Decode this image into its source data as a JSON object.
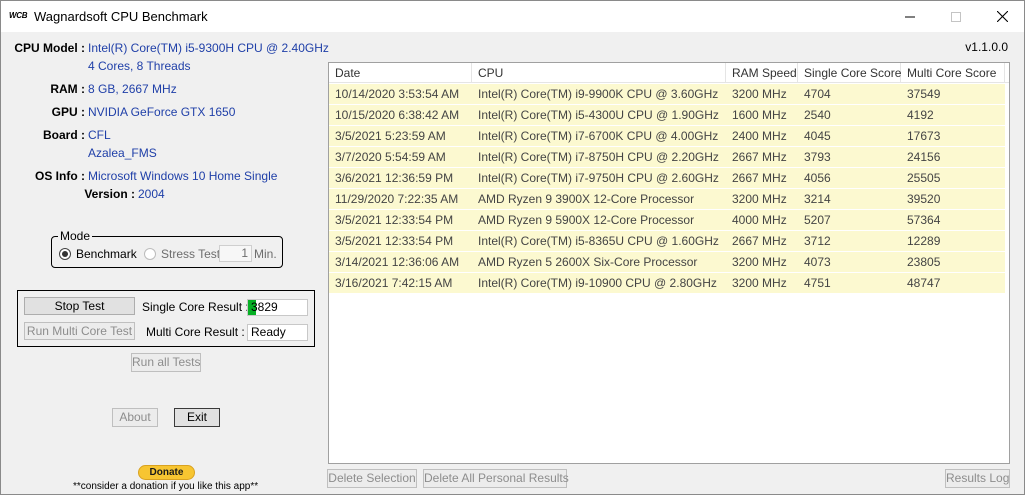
{
  "window": {
    "logo": "WCB",
    "title": "Wagnardsoft CPU Benchmark"
  },
  "system": {
    "cpu_label": "CPU Model :",
    "cpu_line1": "Intel(R) Core(TM) i5-9300H CPU @ 2.40GHz",
    "cpu_line2": "4 Cores, 8 Threads",
    "ram_label": "RAM :",
    "ram": "8 GB, 2667 MHz",
    "gpu_label": "GPU :",
    "gpu": "NVIDIA GeForce GTX 1650",
    "board_label": "Board :",
    "board_line1": "CFL",
    "board_line2": "Azalea_FMS",
    "os_label": "OS Info :",
    "os": "Microsoft Windows 10 Home Single",
    "version_label": "Version :",
    "os_version": "2004"
  },
  "app_version": "v1.1.0.0",
  "mode": {
    "title": "Mode",
    "benchmark_label": "Benchmark",
    "stress_label": "Stress Test",
    "minutes_value": "1",
    "minutes_unit": "Min."
  },
  "tests": {
    "stop_label": "Stop Test",
    "run_multi_label": "Run Multi Core Test",
    "single_label": "Single Core Result :",
    "single_value": "3829",
    "single_progress": 0.14,
    "multi_label": "Multi Core Result :",
    "multi_value": "Ready",
    "run_all_label": "Run all Tests"
  },
  "buttons": {
    "about": "About",
    "exit": "Exit",
    "delete_selection": "Delete Selection",
    "delete_all": "Delete All Personal Results",
    "results_log": "Results Log"
  },
  "donate": {
    "label": "Donate",
    "note": "**consider a donation if you like this app**"
  },
  "results": {
    "columns": [
      "Date",
      "CPU",
      "RAM Speed",
      "Single Core Score",
      "Multi Core Score"
    ],
    "rows": [
      [
        "10/14/2020 3:53:54 AM",
        "Intel(R) Core(TM) i9-9900K CPU @ 3.60GHz",
        "3200 MHz",
        "4704",
        "37549"
      ],
      [
        "10/15/2020 6:38:42 AM",
        "Intel(R) Core(TM) i5-4300U CPU @ 1.90GHz",
        "1600 MHz",
        "2540",
        "4192"
      ],
      [
        "3/5/2021 5:23:59 AM",
        "Intel(R) Core(TM) i7-6700K CPU @ 4.00GHz",
        "2400 MHz",
        "4045",
        "17673"
      ],
      [
        "3/7/2020 5:54:59 AM",
        "Intel(R) Core(TM) i7-8750H CPU @ 2.20GHz",
        "2667 MHz",
        "3793",
        "24156"
      ],
      [
        "3/6/2021 12:36:59 PM",
        "Intel(R) Core(TM) i7-9750H CPU @ 2.60GHz",
        "2667 MHz",
        "4056",
        "25505"
      ],
      [
        "11/29/2020 7:22:35 AM",
        "AMD Ryzen 9 3900X 12-Core Processor",
        "3200 MHz",
        "3214",
        "39520"
      ],
      [
        "3/5/2021 12:33:54 PM",
        "AMD Ryzen 9 5900X 12-Core Processor",
        "4000 MHz",
        "5207",
        "57364"
      ],
      [
        "3/5/2021 12:33:54 PM",
        "Intel(R) Core(TM) i5-8365U CPU @ 1.60GHz",
        "2667 MHz",
        "3712",
        "12289"
      ],
      [
        "3/14/2021 12:36:06 AM",
        "AMD Ryzen 5 2600X Six-Core Processor",
        "3200 MHz",
        "4073",
        "23805"
      ],
      [
        "3/16/2021 7:42:15 AM",
        "Intel(R) Core(TM) i9-10900 CPU @ 2.80GHz",
        "3200 MHz",
        "4751",
        "48747"
      ]
    ]
  }
}
